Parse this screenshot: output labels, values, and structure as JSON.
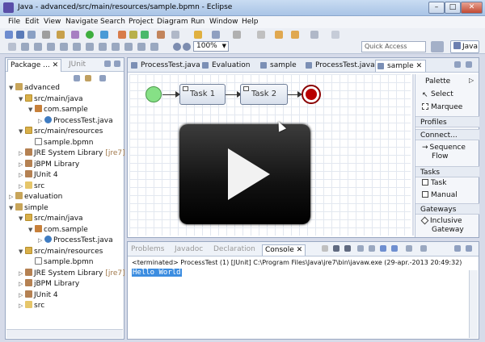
{
  "window": {
    "title": "Java - advanced/src/main/resources/sample.bpmn - Eclipse",
    "min": "–",
    "max": "□",
    "close": "✕"
  },
  "menu": [
    "File",
    "Edit",
    "View",
    "Navigate",
    "Search",
    "Project",
    "Diagram",
    "Run",
    "Window",
    "Help"
  ],
  "toolbar": {
    "zoom": "100%",
    "quick_access": "Quick Access",
    "perspective": "Java"
  },
  "explorer": {
    "tabs": [
      "Package ...",
      "JUnit"
    ],
    "tree": [
      {
        "indent": 0,
        "tw": "▼",
        "icon": "proj",
        "label": "advanced",
        "suffix": ""
      },
      {
        "indent": 1,
        "tw": "▼",
        "icon": "srcf",
        "label": "src/main/java",
        "suffix": ""
      },
      {
        "indent": 2,
        "tw": "▼",
        "icon": "pkg",
        "label": "com.sample",
        "suffix": ""
      },
      {
        "indent": 3,
        "tw": "▷",
        "icon": "java",
        "label": "ProcessTest.java",
        "suffix": ""
      },
      {
        "indent": 1,
        "tw": "▼",
        "icon": "srcf",
        "label": "src/main/resources",
        "suffix": ""
      },
      {
        "indent": 2,
        "tw": "",
        "icon": "file",
        "label": "sample.bpmn",
        "suffix": ""
      },
      {
        "indent": 1,
        "tw": "▷",
        "icon": "lib",
        "label": "JRE System Library",
        "suffix": "[jre7]"
      },
      {
        "indent": 1,
        "tw": "▷",
        "icon": "lib",
        "label": "jBPM Library",
        "suffix": ""
      },
      {
        "indent": 1,
        "tw": "▷",
        "icon": "lib",
        "label": "JUnit 4",
        "suffix": ""
      },
      {
        "indent": 1,
        "tw": "▷",
        "icon": "fold",
        "label": "src",
        "suffix": ""
      },
      {
        "indent": 0,
        "tw": "▷",
        "icon": "proj",
        "label": "evaluation",
        "suffix": ""
      },
      {
        "indent": 0,
        "tw": "▼",
        "icon": "proj",
        "label": "simple",
        "suffix": ""
      },
      {
        "indent": 1,
        "tw": "▼",
        "icon": "srcf",
        "label": "src/main/java",
        "suffix": ""
      },
      {
        "indent": 2,
        "tw": "▼",
        "icon": "pkg",
        "label": "com.sample",
        "suffix": ""
      },
      {
        "indent": 3,
        "tw": "▷",
        "icon": "java",
        "label": "ProcessTest.java",
        "suffix": ""
      },
      {
        "indent": 1,
        "tw": "▼",
        "icon": "srcf",
        "label": "src/main/resources",
        "suffix": ""
      },
      {
        "indent": 2,
        "tw": "",
        "icon": "file",
        "label": "sample.bpmn",
        "suffix": ""
      },
      {
        "indent": 1,
        "tw": "▷",
        "icon": "lib",
        "label": "JRE System Library",
        "suffix": "[jre7]"
      },
      {
        "indent": 1,
        "tw": "▷",
        "icon": "lib",
        "label": "jBPM Library",
        "suffix": ""
      },
      {
        "indent": 1,
        "tw": "▷",
        "icon": "lib",
        "label": "JUnit 4",
        "suffix": ""
      },
      {
        "indent": 1,
        "tw": "▷",
        "icon": "fold",
        "label": "src",
        "suffix": ""
      }
    ]
  },
  "editor": {
    "tabs": [
      "ProcessTest.java",
      "Evaluation",
      "sample",
      "ProcessTest.java",
      "sample"
    ],
    "active_tab_close": "✕",
    "tasks": [
      "Task 1",
      "Task 2"
    ]
  },
  "palette": {
    "title": "Palette",
    "groups": [
      {
        "name": "",
        "items": [
          "Select",
          "Marquee"
        ]
      },
      {
        "name": "Profiles",
        "items": []
      },
      {
        "name": "Connect...",
        "items": [
          "Sequence",
          "Flow"
        ]
      },
      {
        "name": "Tasks",
        "items": [
          "Task",
          "Manual"
        ]
      },
      {
        "name": "Gateways",
        "items": [
          "Inclusive",
          "Gateway"
        ]
      }
    ]
  },
  "console": {
    "tabs": [
      "Problems",
      "Javadoc",
      "Declaration",
      "Console"
    ],
    "status": "<terminated> ProcessTest (1) [JUnit] C:\\Program Files\\Java\\jre7\\bin\\javaw.exe (29-apr.-2013 20:49:32)",
    "output": "Hello World"
  }
}
